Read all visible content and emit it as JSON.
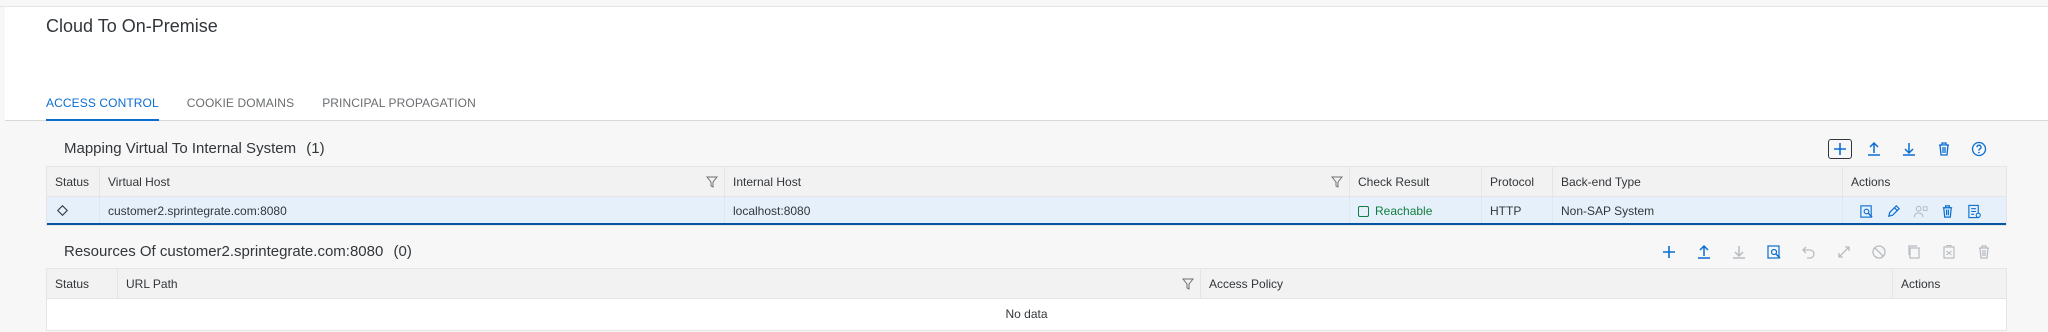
{
  "page": {
    "title": "Cloud To On-Premise"
  },
  "tabs": [
    {
      "label": "ACCESS CONTROL",
      "active": true
    },
    {
      "label": "COOKIE DOMAINS",
      "active": false
    },
    {
      "label": "PRINCIPAL PROPAGATION",
      "active": false
    }
  ],
  "mapping": {
    "title": "Mapping Virtual To Internal System",
    "count": "(1)",
    "toolbar": [
      "add-icon",
      "upload-icon",
      "download-icon",
      "delete-icon",
      "help-icon"
    ],
    "columns": [
      "Status",
      "Virtual Host",
      "Internal Host",
      "Check Result",
      "Protocol",
      "Back-end Type",
      "Actions"
    ],
    "rows": [
      {
        "status_icon": "diamond-icon",
        "virtual_host": "customer2.sprintegrate.com:8080",
        "internal_host": "localhost:8080",
        "check_result": "Reachable",
        "protocol": "HTTP",
        "backend_type": "Non-SAP System",
        "actions": [
          "check-availability-icon",
          "edit-icon",
          "principal-propagation-icon",
          "delete-icon",
          "details-icon"
        ]
      }
    ]
  },
  "resources": {
    "title": "Resources Of customer2.sprintegrate.com:8080",
    "count": "(0)",
    "toolbar": [
      "add-icon",
      "upload-icon",
      "download-icon",
      "check-availability-icon",
      "undo-icon",
      "expand-icon",
      "disable-icon",
      "copy-icon",
      "paste-icon",
      "delete-icon"
    ],
    "columns": [
      "Status",
      "URL Path",
      "Access Policy",
      "Actions"
    ],
    "empty_text": "No data"
  },
  "colors": {
    "accent": "#0a6ed1",
    "success": "#107e3e",
    "selected_row": "#e5f0fa",
    "disabled": "#b7bcc1"
  }
}
